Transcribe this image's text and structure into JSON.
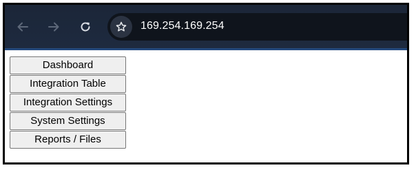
{
  "browser": {
    "url": "169.254.169.254",
    "icons": {
      "back": "arrow-left-icon",
      "forward": "arrow-right-icon",
      "reload": "reload-icon",
      "bookmark": "star-icon"
    },
    "colors": {
      "toolbar": "#1e2a3f",
      "omnibox": "#0f141c",
      "accent_border": "#24497c"
    }
  },
  "menu": {
    "items": [
      {
        "label": "Dashboard"
      },
      {
        "label": "Integration Table"
      },
      {
        "label": "Integration Settings"
      },
      {
        "label": "System Settings"
      },
      {
        "label": "Reports / Files"
      }
    ]
  }
}
